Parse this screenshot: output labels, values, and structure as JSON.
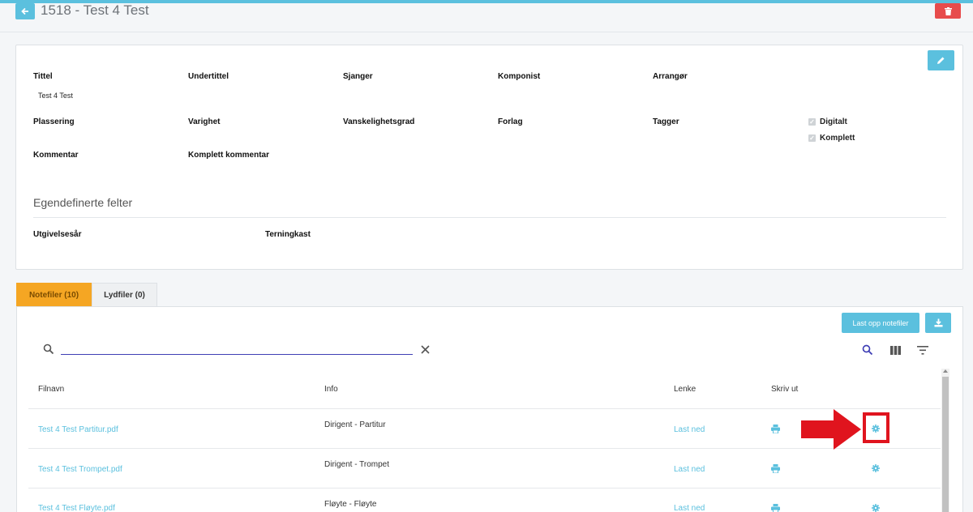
{
  "header": {
    "title": "1518 - Test 4 Test"
  },
  "details": {
    "fields_row1": [
      {
        "label": "Tittel",
        "value": "Test 4 Test"
      },
      {
        "label": "Undertittel",
        "value": ""
      },
      {
        "label": "Sjanger",
        "value": ""
      },
      {
        "label": "Komponist",
        "value": ""
      },
      {
        "label": "Arrangør",
        "value": ""
      }
    ],
    "fields_row2": [
      {
        "label": "Plassering"
      },
      {
        "label": "Varighet"
      },
      {
        "label": "Vanskelighetsgrad"
      },
      {
        "label": "Forlag"
      },
      {
        "label": "Tagger"
      }
    ],
    "checkboxes": [
      {
        "label": "Digitalt",
        "checked": true
      },
      {
        "label": "Komplett",
        "checked": true
      }
    ],
    "fields_row3": [
      {
        "label": "Kommentar"
      },
      {
        "label": "Komplett kommentar"
      }
    ],
    "custom_section_title": "Egendefinerte felter",
    "custom_fields": [
      {
        "label": "Utgivelsesår"
      },
      {
        "label": "Terningkast"
      }
    ]
  },
  "tabs": [
    {
      "label": "Notefiler (10)",
      "active": true
    },
    {
      "label": "Lydfiler (0)",
      "active": false
    }
  ],
  "files": {
    "upload_label": "Last opp notefiler",
    "search_value": "",
    "columns": [
      "Filnavn",
      "Info",
      "Lenke",
      "Skriv ut"
    ],
    "rows": [
      {
        "filename": "Test 4 Test Partitur.pdf",
        "info": "Dirigent - Partitur",
        "link": "Last ned"
      },
      {
        "filename": "Test 4 Test Trompet.pdf",
        "info": "Dirigent - Trompet",
        "link": "Last ned"
      },
      {
        "filename": "Test 4 Test Fløyte.pdf",
        "info": "Fløyte - Fløyte",
        "link": "Last ned"
      }
    ]
  },
  "colors": {
    "accent": "#5bc0de",
    "active_tab": "#f5a623",
    "danger": "#e74c4c",
    "highlight": "#e0141e"
  }
}
